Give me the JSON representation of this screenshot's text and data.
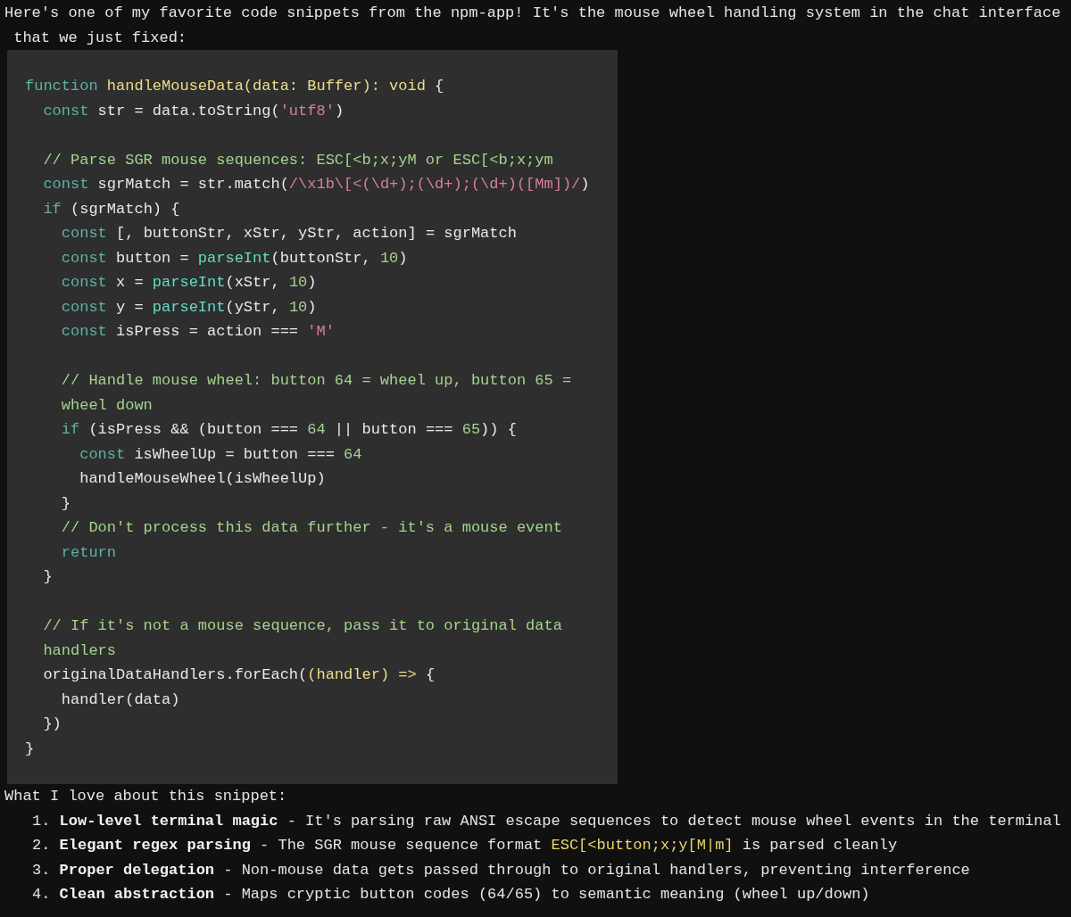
{
  "intro": [
    "Here's one of my favorite code snippets from the npm-app! It's the mouse wheel handling system in the chat interface",
    " that we just fixed:"
  ],
  "code": {
    "blocks": [
      [
        [
          {
            "kind": "keyword",
            "text": "function "
          },
          {
            "kind": "function",
            "text": "handleMouseData(data: Buffer): void "
          },
          {
            "kind": "plain",
            "text": "{"
          }
        ],
        [
          {
            "kind": "keyword",
            "text": "  const"
          },
          {
            "kind": "plain",
            "text": " str = data.toString("
          },
          {
            "kind": "string",
            "text": "'utf8'"
          },
          {
            "kind": "plain",
            "text": ")"
          }
        ]
      ],
      [
        [
          {
            "kind": "comment",
            "text": "  // Parse SGR mouse sequences: ESC[<b;x;yM or ESC[<b;x;ym"
          }
        ],
        [
          {
            "kind": "keyword",
            "text": "  const"
          },
          {
            "kind": "plain",
            "text": " sgrMatch = str.match("
          },
          {
            "kind": "string",
            "text": "/\\x1b\\[<(\\d+);(\\d+);(\\d+)([Mm])/"
          },
          {
            "kind": "plain",
            "text": ")"
          }
        ],
        [
          {
            "kind": "keyword",
            "text": "  if"
          },
          {
            "kind": "plain",
            "text": " (sgrMatch) {"
          }
        ],
        [
          {
            "kind": "keyword",
            "text": "    const"
          },
          {
            "kind": "plain",
            "text": " [, buttonStr, xStr, yStr, action] = sgrMatch"
          }
        ],
        [
          {
            "kind": "keyword",
            "text": "    const"
          },
          {
            "kind": "plain",
            "text": " button = "
          },
          {
            "kind": "call",
            "text": "parseInt"
          },
          {
            "kind": "plain",
            "text": "(buttonStr, "
          },
          {
            "kind": "number",
            "text": "10"
          },
          {
            "kind": "plain",
            "text": ")"
          }
        ],
        [
          {
            "kind": "keyword",
            "text": "    const"
          },
          {
            "kind": "plain",
            "text": " x = "
          },
          {
            "kind": "call",
            "text": "parseInt"
          },
          {
            "kind": "plain",
            "text": "(xStr, "
          },
          {
            "kind": "number",
            "text": "10"
          },
          {
            "kind": "plain",
            "text": ")"
          }
        ],
        [
          {
            "kind": "keyword",
            "text": "    const"
          },
          {
            "kind": "plain",
            "text": " y = "
          },
          {
            "kind": "call",
            "text": "parseInt"
          },
          {
            "kind": "plain",
            "text": "(yStr, "
          },
          {
            "kind": "number",
            "text": "10"
          },
          {
            "kind": "plain",
            "text": ")"
          }
        ],
        [
          {
            "kind": "keyword",
            "text": "    const"
          },
          {
            "kind": "plain",
            "text": " isPress = action === "
          },
          {
            "kind": "string",
            "text": "'M'"
          }
        ]
      ],
      [
        [
          {
            "kind": "comment",
            "text": "    // Handle mouse wheel: button 64 = wheel up, button 65 ="
          }
        ],
        [
          {
            "kind": "comment",
            "text": "    wheel down"
          }
        ],
        [
          {
            "kind": "keyword",
            "text": "    if"
          },
          {
            "kind": "plain",
            "text": " (isPress && (button === "
          },
          {
            "kind": "number",
            "text": "64"
          },
          {
            "kind": "plain",
            "text": " || button === "
          },
          {
            "kind": "number",
            "text": "65"
          },
          {
            "kind": "plain",
            "text": ")) {"
          }
        ],
        [
          {
            "kind": "keyword",
            "text": "      const"
          },
          {
            "kind": "plain",
            "text": " isWheelUp = button === "
          },
          {
            "kind": "number",
            "text": "64"
          }
        ],
        [
          {
            "kind": "plain",
            "text": "      handleMouseWheel(isWheelUp)"
          }
        ],
        [
          {
            "kind": "plain",
            "text": "    }"
          }
        ],
        [
          {
            "kind": "comment",
            "text": "    // Don't process this data further - it's a mouse event"
          }
        ],
        [
          {
            "kind": "keyword",
            "text": "    return"
          }
        ],
        [
          {
            "kind": "plain",
            "text": "  }"
          }
        ]
      ],
      [
        [
          {
            "kind": "comment",
            "text": "  // If it's not a mouse sequence, pass it to original data"
          }
        ],
        [
          {
            "kind": "comment",
            "text": "  handlers"
          }
        ],
        [
          {
            "kind": "plain",
            "text": "  originalDataHandlers.forEach("
          },
          {
            "kind": "function",
            "text": "(handler) =>"
          },
          {
            "kind": "plain",
            "text": " {"
          }
        ],
        [
          {
            "kind": "plain",
            "text": "    handler(data)"
          }
        ],
        [
          {
            "kind": "plain",
            "text": "  })"
          }
        ],
        [
          {
            "kind": "plain",
            "text": "}"
          }
        ]
      ]
    ]
  },
  "summary": {
    "heading": "What I love about this snippet:",
    "items": [
      {
        "number": "1.",
        "title": "Low-level terminal magic",
        "parts": [
          {
            "kind": "plain",
            "text": " - It's parsing raw ANSI escape sequences to detect mouse wheel events in the terminal"
          }
        ]
      },
      {
        "number": "2.",
        "title": "Elegant regex parsing",
        "parts": [
          {
            "kind": "plain",
            "text": " - The SGR mouse sequence format "
          },
          {
            "kind": "code",
            "text": "ESC[<button;x;y[M|m]"
          },
          {
            "kind": "plain",
            "text": " is parsed cleanly"
          }
        ]
      },
      {
        "number": "3.",
        "title": "Proper delegation",
        "parts": [
          {
            "kind": "plain",
            "text": " - Non-mouse data gets passed through to original handlers, preventing interference"
          }
        ]
      },
      {
        "number": "4.",
        "title": "Clean abstraction",
        "parts": [
          {
            "kind": "plain",
            "text": " - Maps cryptic button codes (64/65) to semantic meaning (wheel up/down)"
          }
        ]
      }
    ]
  }
}
